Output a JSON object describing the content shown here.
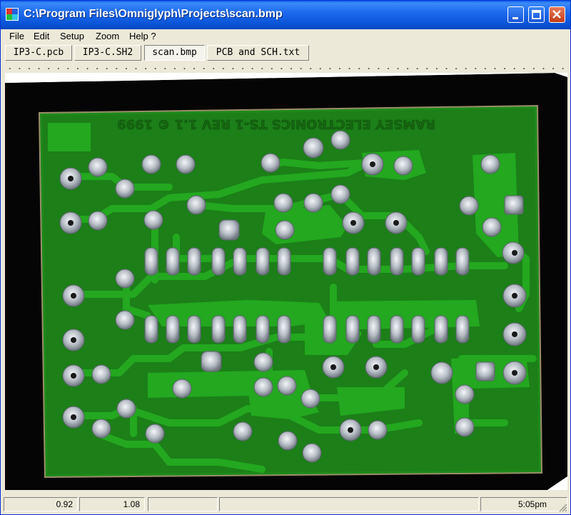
{
  "window": {
    "title": "C:\\Program Files\\Omniglyph\\Projects\\scan.bmp"
  },
  "menu": [
    {
      "label": "File",
      "mnemonic": "F"
    },
    {
      "label": "Edit",
      "mnemonic": "E"
    },
    {
      "label": "Setup",
      "mnemonic": "S"
    },
    {
      "label": "Zoom",
      "mnemonic": "Z"
    },
    {
      "label": "Help ?",
      "mnemonic": "H"
    }
  ],
  "tabs": [
    {
      "label": "IP3-C.pcb",
      "active": false
    },
    {
      "label": "IP3-C.SH2",
      "active": false
    },
    {
      "label": "scan.bmp",
      "active": true
    },
    {
      "label": "PCB and SCH.txt",
      "active": false
    }
  ],
  "image": {
    "silkscreen_text": "RAMSEY ELECTRONICS TS-1 REV 1.1 © 1999",
    "board_color": "#1E8A1A",
    "trace_color": "#22A51E",
    "pad_color": "#C8CDD3"
  },
  "status": {
    "x": "0.92",
    "y": "1.08",
    "time": "5:05pm"
  },
  "colors": {
    "titlebar": "#0A54D8",
    "window_bg": "#ECE9D8"
  }
}
